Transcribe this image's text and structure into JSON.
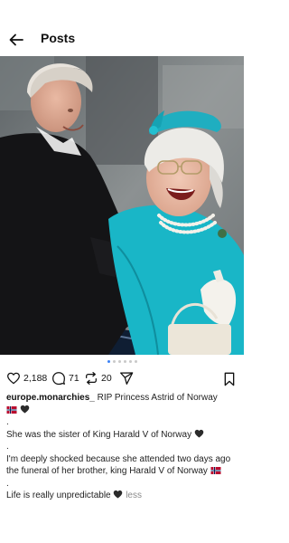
{
  "header": {
    "title": "Posts"
  },
  "post": {
    "icons": {
      "back": "arrow-left-icon",
      "like": "heart-icon",
      "comment": "comment-bubble-icon",
      "repost": "repost-icon",
      "share": "send-icon",
      "save": "bookmark-icon"
    },
    "carousel": {
      "count": 6,
      "active_index": 0
    },
    "counts": {
      "likes": "2,188",
      "comments": "71",
      "reposts": "20"
    },
    "caption": {
      "username": "europe.monarchies_",
      "headline": "RIP Princess Astrid of Norway",
      "separator": ".",
      "line_sister": "She was the sister of King Harald V of Norway",
      "line_shocked": "I'm deeply shocked because she attended two days ago the funeral of her brother, king Harald V of Norway",
      "line_life": "Life is really unpredictable",
      "less_label": "less"
    },
    "colors": {
      "accent": "#3b82f6",
      "muted": "#8a8a8a",
      "flag_red": "#ba0c2f",
      "flag_blue": "#00205b"
    }
  }
}
